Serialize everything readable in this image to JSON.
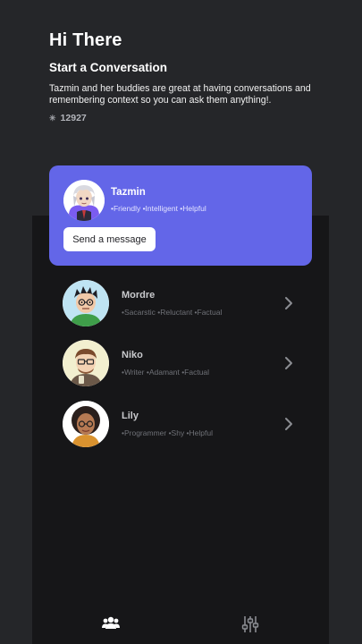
{
  "header": {
    "greeting": "Hi There",
    "subtitle": "Start a Conversation",
    "description": "Tazmin and her buddies are great at having conversations and remembering context so you can ask them anything!.",
    "counter_icon": "sparkle-icon",
    "counter_value": "12927"
  },
  "featured": {
    "name": "Tazmin",
    "traits": "•Friendly •Intelligent •Helpful",
    "button_label": "Send a message",
    "accent_color": "#6366e8"
  },
  "bots": [
    {
      "name": "Mordre",
      "traits": "•Sacarstic  •Reluctant  •Factual"
    },
    {
      "name": "Niko",
      "traits": "•Writer  •Adamant  •Factual"
    },
    {
      "name": "Lily",
      "traits": "•Programmer  •Shy  •Helpful"
    }
  ],
  "tabbar": {
    "tabs": [
      {
        "icon": "users-icon",
        "active": true
      },
      {
        "icon": "sliders-icon",
        "active": false
      }
    ]
  }
}
